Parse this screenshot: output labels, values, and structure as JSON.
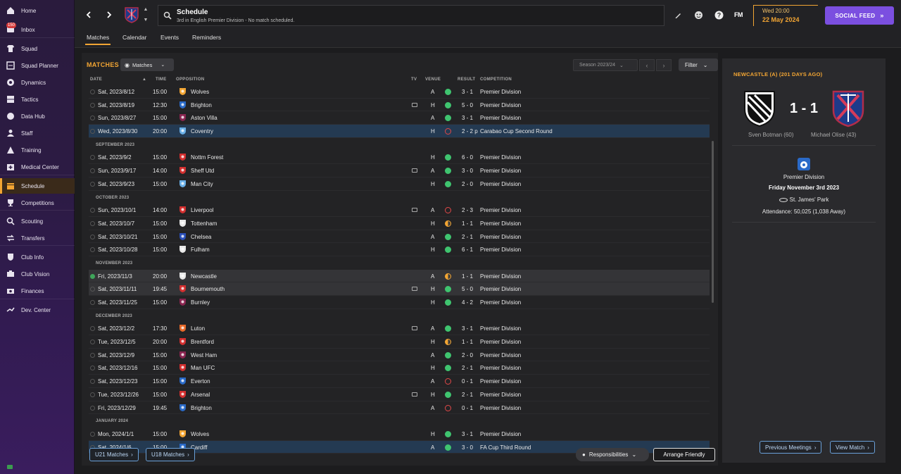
{
  "nav": [
    {
      "label": "Home",
      "icon": "home-icon"
    },
    {
      "label": "Inbox",
      "icon": "inbox-icon",
      "badge": "150"
    },
    {
      "label": "Squad",
      "icon": "shirt-icon"
    },
    {
      "label": "Squad Planner",
      "icon": "squad-planner-icon"
    },
    {
      "label": "Dynamics",
      "icon": "dynamics-icon"
    },
    {
      "label": "Tactics",
      "icon": "tactics-icon"
    },
    {
      "label": "Data Hub",
      "icon": "data-hub-icon"
    },
    {
      "label": "Staff",
      "icon": "staff-icon"
    },
    {
      "label": "Training",
      "icon": "training-icon"
    },
    {
      "label": "Medical Center",
      "icon": "medical-icon"
    },
    {
      "label": "Schedule",
      "icon": "calendar-icon",
      "active": true
    },
    {
      "label": "Competitions",
      "icon": "trophy-icon"
    },
    {
      "label": "Scouting",
      "icon": "scouting-icon"
    },
    {
      "label": "Transfers",
      "icon": "transfers-icon"
    },
    {
      "label": "Club Info",
      "icon": "shield-icon"
    },
    {
      "label": "Club Vision",
      "icon": "club-vision-icon"
    },
    {
      "label": "Finances",
      "icon": "finances-icon"
    },
    {
      "label": "Dev. Center",
      "icon": "dev-center-icon"
    }
  ],
  "header": {
    "title": "Schedule",
    "subtitle": "3rd in English Premier Division - No match scheduled.",
    "fm_logo": "FM",
    "date_line1": "Wed 20:00",
    "date_line2": "22 May 2024",
    "social_feed": "SOCIAL FEED"
  },
  "tabs": [
    "Matches",
    "Calendar",
    "Events",
    "Reminders"
  ],
  "panel": {
    "heading": "MATCHES",
    "view_dropdown": "Matches",
    "season": "Season 2023/24",
    "filter": "Filter",
    "columns": {
      "date": "DATE",
      "time": "TIME",
      "opposition": "OPPOSITION",
      "tv": "TV",
      "venue": "VENUE",
      "result": "RESULT",
      "competition": "COMPETITION"
    },
    "bottom_buttons": {
      "u21": "U21 Matches",
      "u18": "U18 Matches",
      "responsibilities": "Responsibilities",
      "arrange": "Arrange Friendly"
    }
  },
  "matches": [
    {
      "date": "Sat, 2023/8/12",
      "time": "15:00",
      "opp": "Wolves",
      "tv": false,
      "venue": "A",
      "res": "W",
      "score": "3 - 1",
      "comp": "Premier Division",
      "crest": "#f2a533"
    },
    {
      "date": "Sat, 2023/8/19",
      "time": "12:30",
      "opp": "Brighton",
      "tv": true,
      "venue": "H",
      "res": "W",
      "score": "5 - 0",
      "comp": "Premier Division",
      "crest": "#2a6ac8"
    },
    {
      "date": "Sun, 2023/8/27",
      "time": "15:00",
      "opp": "Aston Villa",
      "tv": false,
      "venue": "A",
      "res": "W",
      "score": "3 - 1",
      "comp": "Premier Division",
      "crest": "#8a2550"
    },
    {
      "date": "Wed, 2023/8/30",
      "time": "20:00",
      "opp": "Coventry",
      "tv": false,
      "venue": "H",
      "res": "L",
      "score": "2 - 2 p",
      "comp": "Carabao Cup Second Round",
      "crest": "#6ab0e8",
      "sel": true
    },
    {
      "month": "SEPTEMBER 2023"
    },
    {
      "date": "Sat, 2023/9/2",
      "time": "15:00",
      "opp": "Nottm Forest",
      "tv": false,
      "venue": "H",
      "res": "W",
      "score": "6 - 0",
      "comp": "Premier Division",
      "crest": "#d32f2f"
    },
    {
      "date": "Sun, 2023/9/17",
      "time": "14:00",
      "opp": "Sheff Utd",
      "tv": true,
      "venue": "A",
      "res": "W",
      "score": "3 - 0",
      "comp": "Premier Division",
      "crest": "#d32f2f"
    },
    {
      "date": "Sat, 2023/9/23",
      "time": "15:00",
      "opp": "Man City",
      "tv": false,
      "venue": "H",
      "res": "W",
      "score": "2 - 0",
      "comp": "Premier Division",
      "crest": "#6ab0e8"
    },
    {
      "month": "OCTOBER 2023"
    },
    {
      "date": "Sun, 2023/10/1",
      "time": "14:00",
      "opp": "Liverpool",
      "tv": true,
      "venue": "A",
      "res": "L",
      "score": "2 - 3",
      "comp": "Premier Division",
      "crest": "#d32f2f"
    },
    {
      "date": "Sat, 2023/10/7",
      "time": "15:00",
      "opp": "Tottenham",
      "tv": false,
      "venue": "H",
      "res": "D",
      "score": "1 - 1",
      "comp": "Premier Division",
      "crest": "#e8e8e8"
    },
    {
      "date": "Sat, 2023/10/21",
      "time": "15:00",
      "opp": "Chelsea",
      "tv": false,
      "venue": "A",
      "res": "W",
      "score": "2 - 1",
      "comp": "Premier Division",
      "crest": "#2a4fb8"
    },
    {
      "date": "Sat, 2023/10/28",
      "time": "15:00",
      "opp": "Fulham",
      "tv": false,
      "venue": "H",
      "res": "W",
      "score": "6 - 1",
      "comp": "Premier Division",
      "crest": "#e8e8e8"
    },
    {
      "month": "NOVEMBER 2023"
    },
    {
      "date": "Fri, 2023/11/3",
      "time": "20:00",
      "opp": "Newcastle",
      "tv": false,
      "venue": "A",
      "res": "D",
      "score": "1 - 1",
      "comp": "Premier Division",
      "crest": "#e8e8e8",
      "hl": true,
      "done": true
    },
    {
      "date": "Sat, 2023/11/11",
      "time": "19:45",
      "opp": "Bournemouth",
      "tv": true,
      "venue": "H",
      "res": "W",
      "score": "5 - 0",
      "comp": "Premier Division",
      "crest": "#d32f2f",
      "hl": true
    },
    {
      "date": "Sat, 2023/11/25",
      "time": "15:00",
      "opp": "Burnley",
      "tv": false,
      "venue": "H",
      "res": "W",
      "score": "4 - 2",
      "comp": "Premier Division",
      "crest": "#8a2550"
    },
    {
      "month": "DECEMBER 2023"
    },
    {
      "date": "Sat, 2023/12/2",
      "time": "17:30",
      "opp": "Luton",
      "tv": true,
      "venue": "A",
      "res": "W",
      "score": "3 - 1",
      "comp": "Premier Division",
      "crest": "#e86a2a"
    },
    {
      "date": "Tue, 2023/12/5",
      "time": "20:00",
      "opp": "Brentford",
      "tv": false,
      "venue": "H",
      "res": "D",
      "score": "1 - 1",
      "comp": "Premier Division",
      "crest": "#d32f2f"
    },
    {
      "date": "Sat, 2023/12/9",
      "time": "15:00",
      "opp": "West Ham",
      "tv": false,
      "venue": "A",
      "res": "W",
      "score": "2 - 0",
      "comp": "Premier Division",
      "crest": "#8a2550"
    },
    {
      "date": "Sat, 2023/12/16",
      "time": "15:00",
      "opp": "Man UFC",
      "tv": false,
      "venue": "H",
      "res": "W",
      "score": "2 - 1",
      "comp": "Premier Division",
      "crest": "#d32f2f"
    },
    {
      "date": "Sat, 2023/12/23",
      "time": "15:00",
      "opp": "Everton",
      "tv": false,
      "venue": "A",
      "res": "L",
      "score": "0 - 1",
      "comp": "Premier Division",
      "crest": "#2a6ac8"
    },
    {
      "date": "Tue, 2023/12/26",
      "time": "15:00",
      "opp": "Arsenal",
      "tv": true,
      "venue": "H",
      "res": "W",
      "score": "2 - 1",
      "comp": "Premier Division",
      "crest": "#d32f2f"
    },
    {
      "date": "Fri, 2023/12/29",
      "time": "19:45",
      "opp": "Brighton",
      "tv": false,
      "venue": "A",
      "res": "L",
      "score": "0 - 1",
      "comp": "Premier Division",
      "crest": "#2a6ac8"
    },
    {
      "month": "JANUARY 2024"
    },
    {
      "date": "Mon, 2024/1/1",
      "time": "15:00",
      "opp": "Wolves",
      "tv": false,
      "venue": "H",
      "res": "W",
      "score": "3 - 1",
      "comp": "Premier Division",
      "crest": "#f2a533"
    },
    {
      "date": "Sat, 2024/1/6",
      "time": "15:00",
      "opp": "Cardiff",
      "tv": false,
      "venue": "A",
      "res": "W",
      "score": "3 - 0",
      "comp": "FA Cup Third Round",
      "crest": "#2a6ac8",
      "sel": true
    }
  ],
  "detail": {
    "title": "NEWCASTLE (A) (201 DAYS AGO)",
    "score": "1 - 1",
    "home_scorer": "Sven Botman (60)",
    "away_scorer": "Michael Olise (43)",
    "competition": "Premier Division",
    "date": "Friday November 3rd 2023",
    "stadium": "St. James' Park",
    "attendance": "Attendance: 50,025 (1,038 Away)",
    "prev_meetings": "Previous Meetings",
    "view_match": "View Match"
  },
  "colors": {
    "accent": "#f2a533",
    "social": "#7b4fe0",
    "win": "#3fc46f",
    "loss": "#e04848",
    "link": "#6aa0d8"
  }
}
